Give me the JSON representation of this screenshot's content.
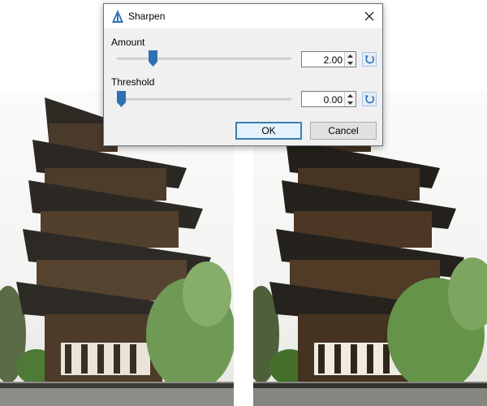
{
  "dialog": {
    "title": "Sharpen",
    "amount": {
      "label": "Amount",
      "value": "2.00",
      "slider_fraction": 0.19
    },
    "threshold": {
      "label": "Threshold",
      "value": "0.00",
      "slider_fraction": 0.0
    },
    "ok_label": "OK",
    "cancel_label": "Cancel"
  },
  "icons": {
    "app": "sharpen-app-icon",
    "close": "close-icon",
    "spin_up": "spin-up-icon",
    "spin_down": "spin-down-icon",
    "reset": "reset-icon"
  },
  "colors": {
    "accent": "#2f6fb3",
    "default_button_border": "#3c7fb1",
    "reset_button_bg": "#e4eef8"
  }
}
